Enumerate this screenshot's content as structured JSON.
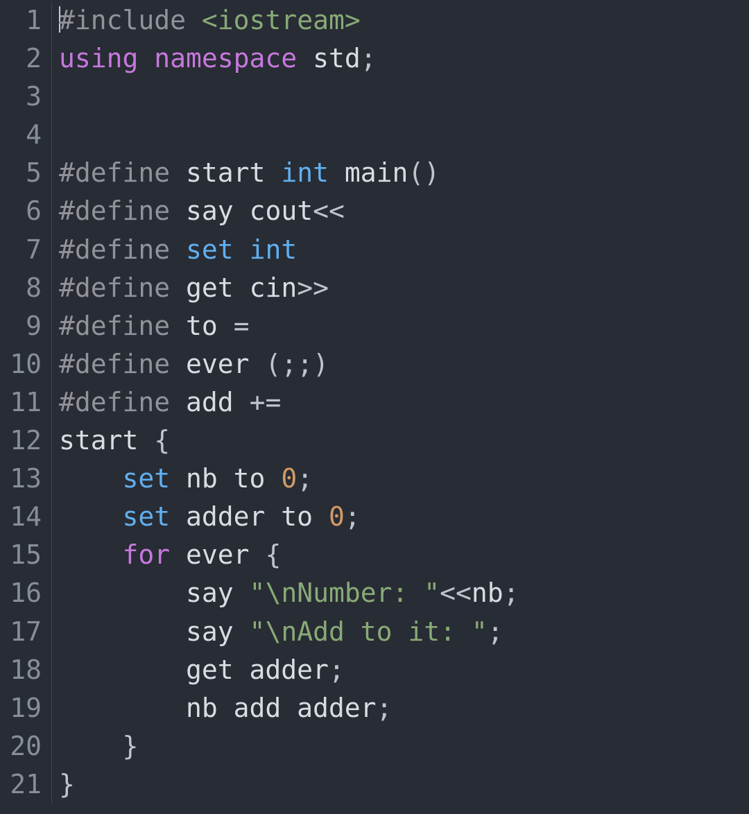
{
  "lines": [
    {
      "n": "1",
      "tokens": [
        {
          "c": "cursor"
        },
        {
          "t": "#",
          "c": "tk-preproc-hash"
        },
        {
          "t": "include ",
          "c": "tk-preproc-kw"
        },
        {
          "t": "<iostream>",
          "c": "tk-include-target"
        }
      ]
    },
    {
      "n": "2",
      "tokens": [
        {
          "t": "using",
          "c": "tk-keyword"
        },
        {
          "t": " ",
          "c": ""
        },
        {
          "t": "namespace",
          "c": "tk-keyword"
        },
        {
          "t": " ",
          "c": ""
        },
        {
          "t": "std",
          "c": "tk-ident"
        },
        {
          "t": ";",
          "c": "tk-punct"
        }
      ]
    },
    {
      "n": "3",
      "tokens": []
    },
    {
      "n": "4",
      "tokens": []
    },
    {
      "n": "5",
      "tokens": [
        {
          "t": "#",
          "c": "tk-preproc-hash"
        },
        {
          "t": "define ",
          "c": "tk-preproc-kw"
        },
        {
          "t": "start ",
          "c": "tk-macrodef"
        },
        {
          "t": "int",
          "c": "tk-type"
        },
        {
          "t": " ",
          "c": ""
        },
        {
          "t": "main",
          "c": "tk-func"
        },
        {
          "t": "()",
          "c": "tk-punct"
        }
      ]
    },
    {
      "n": "6",
      "tokens": [
        {
          "t": "#",
          "c": "tk-preproc-hash"
        },
        {
          "t": "define ",
          "c": "tk-preproc-kw"
        },
        {
          "t": "say ",
          "c": "tk-macrodef"
        },
        {
          "t": "cout",
          "c": "tk-ident"
        },
        {
          "t": "<<",
          "c": "tk-punct"
        }
      ]
    },
    {
      "n": "7",
      "tokens": [
        {
          "t": "#",
          "c": "tk-preproc-hash"
        },
        {
          "t": "define ",
          "c": "tk-preproc-kw"
        },
        {
          "t": "set",
          "c": "tk-set-alias"
        },
        {
          "t": " ",
          "c": ""
        },
        {
          "t": "int",
          "c": "tk-type"
        }
      ]
    },
    {
      "n": "8",
      "tokens": [
        {
          "t": "#",
          "c": "tk-preproc-hash"
        },
        {
          "t": "define ",
          "c": "tk-preproc-kw"
        },
        {
          "t": "get ",
          "c": "tk-macrodef"
        },
        {
          "t": "cin",
          "c": "tk-ident"
        },
        {
          "t": ">>",
          "c": "tk-punct"
        }
      ]
    },
    {
      "n": "9",
      "tokens": [
        {
          "t": "#",
          "c": "tk-preproc-hash"
        },
        {
          "t": "define ",
          "c": "tk-preproc-kw"
        },
        {
          "t": "to ",
          "c": "tk-macrodef"
        },
        {
          "t": "=",
          "c": "tk-punct"
        }
      ]
    },
    {
      "n": "10",
      "tokens": [
        {
          "t": "#",
          "c": "tk-preproc-hash"
        },
        {
          "t": "define ",
          "c": "tk-preproc-kw"
        },
        {
          "t": "ever ",
          "c": "tk-macrodef"
        },
        {
          "t": "(;;)",
          "c": "tk-punct"
        }
      ]
    },
    {
      "n": "11",
      "tokens": [
        {
          "t": "#",
          "c": "tk-preproc-hash"
        },
        {
          "t": "define ",
          "c": "tk-preproc-kw"
        },
        {
          "t": "add ",
          "c": "tk-macrodef"
        },
        {
          "t": "+=",
          "c": "tk-punct"
        }
      ]
    },
    {
      "n": "12",
      "tokens": [
        {
          "t": "start ",
          "c": "tk-ident"
        },
        {
          "t": "{",
          "c": "tk-punct"
        }
      ]
    },
    {
      "n": "13",
      "tokens": [
        {
          "t": "    ",
          "c": ""
        },
        {
          "t": "set",
          "c": "tk-set-alias"
        },
        {
          "t": " nb to ",
          "c": "tk-ident"
        },
        {
          "t": "0",
          "c": "tk-num"
        },
        {
          "t": ";",
          "c": "tk-punct"
        }
      ]
    },
    {
      "n": "14",
      "tokens": [
        {
          "t": "    ",
          "c": ""
        },
        {
          "t": "set",
          "c": "tk-set-alias"
        },
        {
          "t": " adder to ",
          "c": "tk-ident"
        },
        {
          "t": "0",
          "c": "tk-num"
        },
        {
          "t": ";",
          "c": "tk-punct"
        }
      ]
    },
    {
      "n": "15",
      "tokens": [
        {
          "t": "    ",
          "c": ""
        },
        {
          "t": "for",
          "c": "tk-for"
        },
        {
          "t": " ever ",
          "c": "tk-ident"
        },
        {
          "t": "{",
          "c": "tk-punct"
        }
      ]
    },
    {
      "n": "16",
      "tokens": [
        {
          "t": "        say ",
          "c": "tk-ident"
        },
        {
          "t": "\"",
          "c": "tk-string"
        },
        {
          "t": "\\n",
          "c": "tk-escape"
        },
        {
          "t": "Number: \"",
          "c": "tk-string"
        },
        {
          "t": "<<",
          "c": "tk-punct"
        },
        {
          "t": "nb",
          "c": "tk-ident"
        },
        {
          "t": ";",
          "c": "tk-punct"
        }
      ]
    },
    {
      "n": "17",
      "tokens": [
        {
          "t": "        say ",
          "c": "tk-ident"
        },
        {
          "t": "\"",
          "c": "tk-string"
        },
        {
          "t": "\\n",
          "c": "tk-escape"
        },
        {
          "t": "Add to it: \"",
          "c": "tk-string"
        },
        {
          "t": ";",
          "c": "tk-punct"
        }
      ]
    },
    {
      "n": "18",
      "tokens": [
        {
          "t": "        get adder",
          "c": "tk-ident"
        },
        {
          "t": ";",
          "c": "tk-punct"
        }
      ]
    },
    {
      "n": "19",
      "tokens": [
        {
          "t": "        nb add adder",
          "c": "tk-ident"
        },
        {
          "t": ";",
          "c": "tk-punct"
        }
      ]
    },
    {
      "n": "20",
      "tokens": [
        {
          "t": "    ",
          "c": ""
        },
        {
          "t": "}",
          "c": "tk-punct"
        }
      ]
    },
    {
      "n": "21",
      "tokens": [
        {
          "t": "}",
          "c": "tk-punct"
        }
      ]
    }
  ]
}
